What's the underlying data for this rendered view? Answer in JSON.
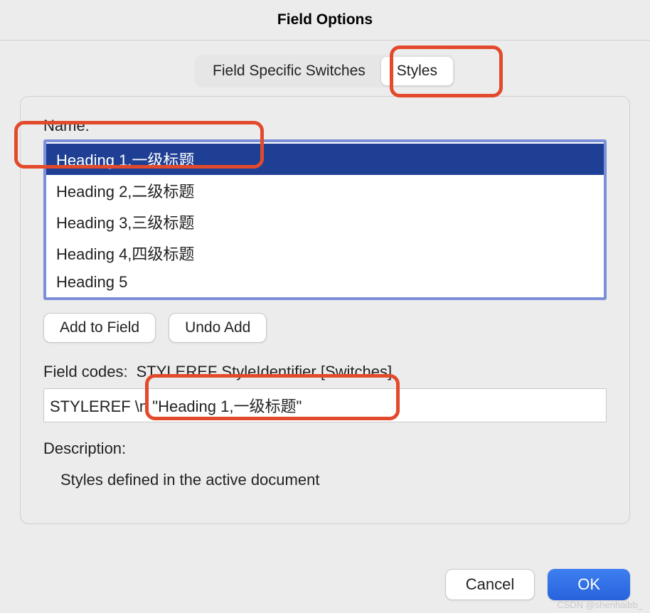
{
  "window_title": "Field Options",
  "tabs": {
    "switches": "Field Specific Switches",
    "styles": "Styles"
  },
  "panel": {
    "name_label": "Name:",
    "items": [
      "Heading 1,一级标题",
      "Heading 2,二级标题",
      "Heading 3,三级标题",
      "Heading 4,四级标题",
      "Heading 5"
    ],
    "add_to_field": "Add to Field",
    "undo_add": "Undo Add",
    "field_codes_label": "Field codes:",
    "field_codes_desc": "STYLEREF StyleIdentifier [Switches]",
    "field_codes_value": "STYLEREF \\n \"Heading 1,一级标题\"",
    "description_label": "Description:",
    "description_text": "Styles defined in the active document"
  },
  "footer": {
    "cancel": "Cancel",
    "ok": "OK"
  },
  "watermark": "CSDN @shenhaibb_"
}
